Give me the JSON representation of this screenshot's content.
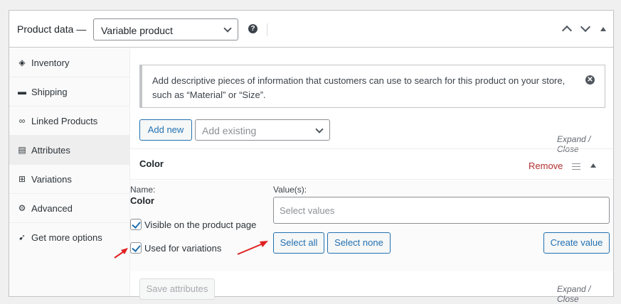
{
  "header": {
    "title": "Product data —",
    "product_type": "Variable product",
    "help_glyph": "?"
  },
  "tabs": [
    {
      "label": "Inventory",
      "icon": "tag-icon",
      "glyph": "◈"
    },
    {
      "label": "Shipping",
      "icon": "truck-icon",
      "glyph": "▬"
    },
    {
      "label": "Linked Products",
      "icon": "link-icon",
      "glyph": "∞"
    },
    {
      "label": "Attributes",
      "icon": "list-icon",
      "glyph": "▤"
    },
    {
      "label": "Variations",
      "icon": "grid-icon",
      "glyph": "⊞"
    },
    {
      "label": "Advanced",
      "icon": "gear-icon",
      "glyph": "⚙"
    },
    {
      "label": "Get more options",
      "icon": "plugin-icon",
      "glyph": "➹"
    }
  ],
  "active_tab": "Attributes",
  "notice": {
    "text": "Add descriptive pieces of information that customers can use to search for this product on your store, such as “Material” or “Size”.",
    "dismiss_glyph": "✕"
  },
  "toolbar": {
    "add_new": "Add new",
    "add_existing_placeholder": "Add existing",
    "expand_close": "Expand / Close"
  },
  "attribute": {
    "title": "Color",
    "remove": "Remove",
    "name_label": "Name:",
    "name_value": "Color",
    "visible_label": "Visible on the product page",
    "visible_checked": true,
    "variations_label": "Used for variations",
    "variations_checked": true,
    "values_label": "Value(s):",
    "values_placeholder": "Select values",
    "select_all": "Select all",
    "select_none": "Select none",
    "create_value": "Create value"
  },
  "footer": {
    "save": "Save attributes",
    "expand_close": "Expand / Close"
  },
  "colors": {
    "accent": "#2271b1",
    "remove": "#b32d2e",
    "annotation_arrow": "#e02020"
  }
}
